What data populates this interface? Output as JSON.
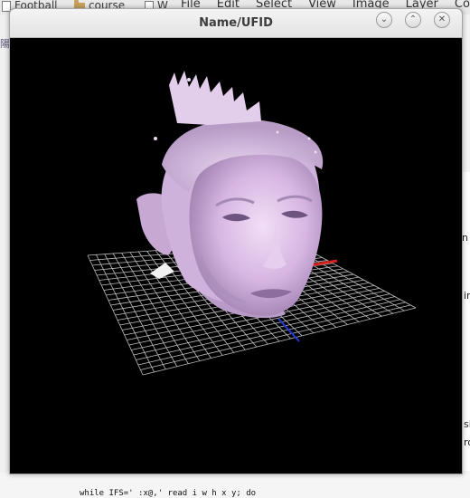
{
  "background": {
    "tabs": [
      {
        "label": "Football"
      },
      {
        "label": "course"
      },
      {
        "label": "W"
      }
    ],
    "menu": [
      "File",
      "Edit",
      "Select",
      "View",
      "Image",
      "Layer",
      "Color"
    ],
    "right_snippets": [
      "n a",
      "in",
      "si",
      "ro"
    ],
    "left_char": "陽",
    "code_line": "while IFS=' :x@,' read i w h x y; do"
  },
  "window": {
    "title": "Name/UFID",
    "buttons": {
      "minimize": "⌄",
      "maximize": "⌃",
      "close": "✕"
    }
  },
  "viewer": {
    "background_color": "#000000",
    "face_color": "#d9b8e3",
    "grid_color": "#bdbdbd",
    "axis_x_color": "#d62020",
    "axis_z_color": "#2038e0"
  }
}
